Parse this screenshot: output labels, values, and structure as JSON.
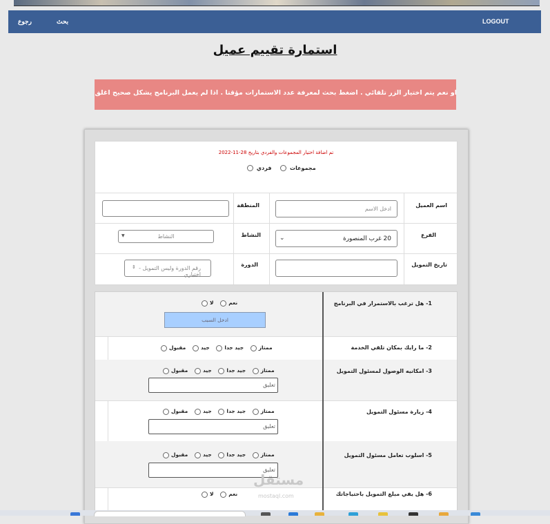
{
  "nav": {
    "logout": "LOGOUT",
    "search": "بحث",
    "back": "رجوع"
  },
  "page_title": "استمارة تقييم عميل",
  "notice_text": "او نعم يتم اختيار الزر تلقائي . اضغط بحث لمعرفة عدد الاستمارات مؤقتا . اذا لم يعمل البرنامج يشكل صحيح اغلق المت",
  "form": {
    "added_note": "تم اضافة اختيار المجموعات والفردي بتاريخ 28-11-2022",
    "type_individual": "فردي",
    "type_groups": "مجموعات",
    "client_name_label": "اسم العميل",
    "client_name_placeholder": "ادخل الاسم",
    "region_label": "المنطقة",
    "branch_label": "الفرع",
    "branch_value": "20 غرب المنصورة",
    "activity_label": "النشاط",
    "activity_placeholder": "النشاط",
    "funding_date_label": "تاريخ التمويل",
    "cycle_label": "الدورة",
    "cycle_placeholder": "رقم الدورة وليس التمويل - اختياري"
  },
  "questions": {
    "q1": "1- هل ترغب بالاستمرار في البرنامج",
    "q2": "2- ما رايك بمكان تلقي الخدمة",
    "q3": "3- امكانيه الوصول لمسئول التمويل",
    "q4": "4- زيارة مسئول التمويل",
    "q5": "5- اسلوب تعامل مسئول التمويل",
    "q6": "6- هل يفي مبلغ التمويل باحتياجاتك",
    "yes": "نعم",
    "no": "لا",
    "excellent": "ممتاز",
    "very_good": "جيد جدا",
    "good": "جيد",
    "acceptable": "مقبول",
    "reason_placeholder": "ادخل السبب",
    "comment_placeholder": "تعليق"
  },
  "watermark": {
    "main": "مستقل",
    "sub": "mostaql.com"
  }
}
